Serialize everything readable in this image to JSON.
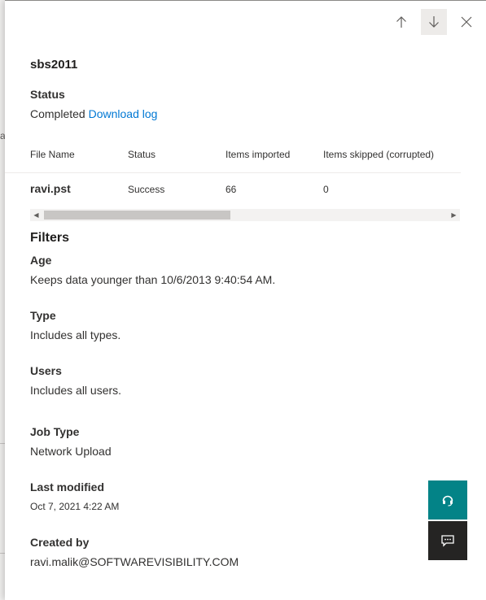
{
  "background": {
    "glyph": "a"
  },
  "panel": {
    "title": "sbs2011",
    "nav": {
      "up_icon": "arrow-up-icon",
      "down_icon": "arrow-down-icon",
      "close_icon": "close-icon"
    },
    "status": {
      "label": "Status",
      "value": "Completed",
      "link": "Download log"
    },
    "table": {
      "headers": [
        "File Name",
        "Status",
        "Items imported",
        "Items skipped (corrupted)"
      ],
      "rows": [
        [
          "ravi.pst",
          "Success",
          "66",
          "0"
        ]
      ]
    },
    "filters": {
      "heading": "Filters",
      "age": {
        "label": "Age",
        "value": "Keeps data younger than 10/6/2013 9:40:54 AM."
      },
      "type": {
        "label": "Type",
        "value": "Includes all types."
      },
      "users": {
        "label": "Users",
        "value": "Includes all users."
      }
    },
    "job_type": {
      "label": "Job Type",
      "value": "Network Upload"
    },
    "last_modified": {
      "label": "Last modified",
      "value": "Oct 7, 2021 4:22 AM"
    },
    "created_by": {
      "label": "Created by",
      "value": "ravi.malik@SOFTWAREVISIBILITY.COM"
    }
  },
  "floating": {
    "help_icon": "headset-icon",
    "feedback_icon": "feedback-icon"
  },
  "colors": {
    "accent": "#0078d4",
    "help_button": "#038387",
    "feedback_button": "#252423"
  }
}
